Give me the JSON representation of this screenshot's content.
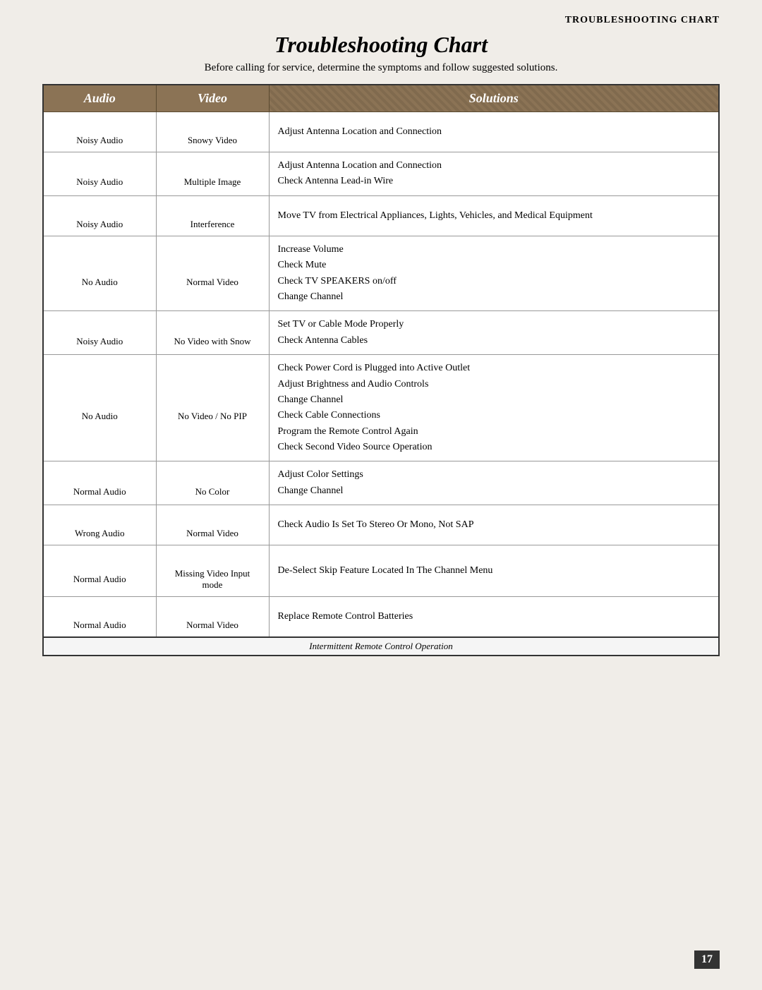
{
  "header": {
    "label": "Troubleshooting Chart"
  },
  "title": "Troubleshooting Chart",
  "subtitle": "Before calling for service, determine the symptoms and follow suggested solutions.",
  "columns": {
    "audio": "Audio",
    "video": "Video",
    "solutions": "Solutions"
  },
  "rows": [
    {
      "audio": "Noisy Audio",
      "audio_type": "noisy",
      "video": "Snowy Video",
      "video_type": "snowy",
      "solutions": [
        "Adjust Antenna Location and Connection"
      ]
    },
    {
      "audio": "Noisy Audio",
      "audio_type": "noisy",
      "video": "Multiple Image",
      "video_type": "normal",
      "solutions": [
        "Adjust Antenna Location and Connection",
        "Check Antenna Lead-in Wire"
      ]
    },
    {
      "audio": "Noisy Audio",
      "audio_type": "noisy",
      "video": "Interference",
      "video_type": "interference",
      "solutions": [
        "Move TV from Electrical Appliances, Lights, Vehicles, and Medical Equipment"
      ]
    },
    {
      "audio": "No Audio",
      "audio_type": "no",
      "video": "Normal Video",
      "video_type": "normal",
      "solutions": [
        "Increase Volume",
        "Check Mute",
        "Check TV SPEAKERS on/off",
        "Change Channel"
      ]
    },
    {
      "audio": "Noisy Audio",
      "audio_type": "noisy",
      "video": "No Video with Snow",
      "video_type": "snow",
      "solutions": [
        "Set TV or Cable Mode Properly",
        "Check Antenna Cables"
      ]
    },
    {
      "audio": "No Audio",
      "audio_type": "no",
      "video": "No Video / No PIP",
      "video_type": "question",
      "solutions": [
        "Check Power Cord is Plugged into Active Outlet",
        "Adjust Brightness and Audio Controls",
        "Change Channel",
        "Check Cable Connections",
        "Program the Remote Control Again",
        "Check Second Video Source Operation"
      ]
    },
    {
      "audio": "Normal Audio",
      "audio_type": "normal",
      "video": "No Color",
      "video_type": "normal",
      "solutions": [
        "Adjust Color Settings",
        "Change Channel"
      ]
    },
    {
      "audio": "Wrong Audio",
      "audio_type": "wrong",
      "video": "Normal Video",
      "video_type": "normal",
      "solutions": [
        "Check Audio Is Set To Stereo Or Mono, Not SAP"
      ]
    },
    {
      "audio": "Normal Audio",
      "audio_type": "normal",
      "video": "Missing Video\nInput mode",
      "video_type": "video1",
      "solutions": [
        "De-Select Skip Feature Located In The Channel Menu"
      ]
    },
    {
      "audio": "Normal Audio",
      "audio_type": "normal",
      "video": "Normal Video",
      "video_type": "normal",
      "solutions": [
        "Replace Remote Control Batteries"
      ],
      "footer": "Intermittent Remote Control Operation"
    }
  ],
  "page_number": "17"
}
